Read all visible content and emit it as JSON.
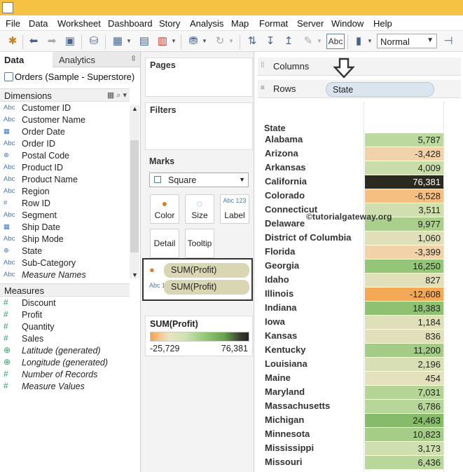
{
  "menu": [
    "File",
    "Data",
    "Worksheet",
    "Dashboard",
    "Story",
    "Analysis",
    "Map",
    "Format",
    "Server",
    "Window",
    "Help"
  ],
  "toolbar": {
    "show_mark_labels": "Abc",
    "fit_value": "Normal"
  },
  "left_pane": {
    "tab_data": "Data",
    "tab_analytics": "Analytics",
    "data_source": "Orders (Sample - Superstore)",
    "dimensions_header": "Dimensions",
    "measures_header": "Measures",
    "dimensions": [
      {
        "type": "Abc",
        "name": "Customer ID"
      },
      {
        "type": "Abc",
        "name": "Customer Name"
      },
      {
        "type": "date",
        "name": "Order Date"
      },
      {
        "type": "Abc",
        "name": "Order ID"
      },
      {
        "type": "geo",
        "name": "Postal Code"
      },
      {
        "type": "Abc",
        "name": "Product ID"
      },
      {
        "type": "Abc",
        "name": "Product Name"
      },
      {
        "type": "Abc",
        "name": "Region"
      },
      {
        "type": "#",
        "name": "Row ID"
      },
      {
        "type": "Abc",
        "name": "Segment"
      },
      {
        "type": "date",
        "name": "Ship Date"
      },
      {
        "type": "Abc",
        "name": "Ship Mode"
      },
      {
        "type": "geo",
        "name": "State"
      },
      {
        "type": "Abc",
        "name": "Sub-Category"
      },
      {
        "type": "Abc",
        "name": "Measure Names"
      }
    ],
    "measures": [
      {
        "type": "#",
        "name": "Discount"
      },
      {
        "type": "#",
        "name": "Profit"
      },
      {
        "type": "#",
        "name": "Quantity"
      },
      {
        "type": "#",
        "name": "Sales"
      },
      {
        "type": "geo",
        "name": "Latitude (generated)"
      },
      {
        "type": "geo",
        "name": "Longitude (generated)"
      },
      {
        "type": "#",
        "name": "Number of Records"
      },
      {
        "type": "#",
        "name": "Measure Values"
      }
    ]
  },
  "cards": {
    "pages": "Pages",
    "filters": "Filters",
    "marks": "Marks",
    "mark_type": "Square",
    "buttons": {
      "color": "Color",
      "size": "Size",
      "label": "Label",
      "detail": "Detail",
      "tooltip": "Tooltip"
    },
    "label_icon": "Abc 123",
    "mark_fields": [
      "SUM(Profit)",
      "SUM(Profit)"
    ],
    "legend_title": "SUM(Profit)",
    "legend_min": "-25,729",
    "legend_max": "76,381"
  },
  "shelves": {
    "columns": "Columns",
    "rows": "Rows",
    "rows_pill": "State"
  },
  "view": {
    "header": "State",
    "watermark": "©tutorialgateway.org",
    "rows": [
      {
        "state": "Alabama",
        "profit": "5,787",
        "color": "#bcd9a0"
      },
      {
        "state": "Arizona",
        "profit": "-3,428",
        "color": "#f2d3a9"
      },
      {
        "state": "Arkansas",
        "profit": "4,009",
        "color": "#c8dda9"
      },
      {
        "state": "California",
        "profit": "76,381",
        "color": "#2b2a21"
      },
      {
        "state": "Colorado",
        "profit": "-6,528",
        "color": "#f4bf80"
      },
      {
        "state": "Connecticut",
        "profit": "3,511",
        "color": "#cfdfae"
      },
      {
        "state": "Delaware",
        "profit": "9,977",
        "color": "#aacf8c"
      },
      {
        "state": "District of Columbia",
        "profit": "1,060",
        "color": "#dfe0b8"
      },
      {
        "state": "Florida",
        "profit": "-3,399",
        "color": "#f2d3a9"
      },
      {
        "state": "Georgia",
        "profit": "16,250",
        "color": "#95c579"
      },
      {
        "state": "Idaho",
        "profit": "827",
        "color": "#e2e0ba"
      },
      {
        "state": "Illinois",
        "profit": "-12,608",
        "color": "#f3a955"
      },
      {
        "state": "Indiana",
        "profit": "18,383",
        "color": "#8fc173"
      },
      {
        "state": "Iowa",
        "profit": "1,184",
        "color": "#dfe0b8"
      },
      {
        "state": "Kansas",
        "profit": "836",
        "color": "#e2e0ba"
      },
      {
        "state": "Kentucky",
        "profit": "11,200",
        "color": "#a4cc86"
      },
      {
        "state": "Louisiana",
        "profit": "2,196",
        "color": "#d8dfb4"
      },
      {
        "state": "Maine",
        "profit": "454",
        "color": "#e4e1bd"
      },
      {
        "state": "Maryland",
        "profit": "7,031",
        "color": "#b5d597"
      },
      {
        "state": "Massachusetts",
        "profit": "6,786",
        "color": "#b7d699"
      },
      {
        "state": "Michigan",
        "profit": "24,463",
        "color": "#86bb6a"
      },
      {
        "state": "Minnesota",
        "profit": "10,823",
        "color": "#a6cd88"
      },
      {
        "state": "Mississippi",
        "profit": "3,173",
        "color": "#d0dfb0"
      },
      {
        "state": "Missouri",
        "profit": "6,436",
        "color": "#b9d79b"
      }
    ]
  }
}
